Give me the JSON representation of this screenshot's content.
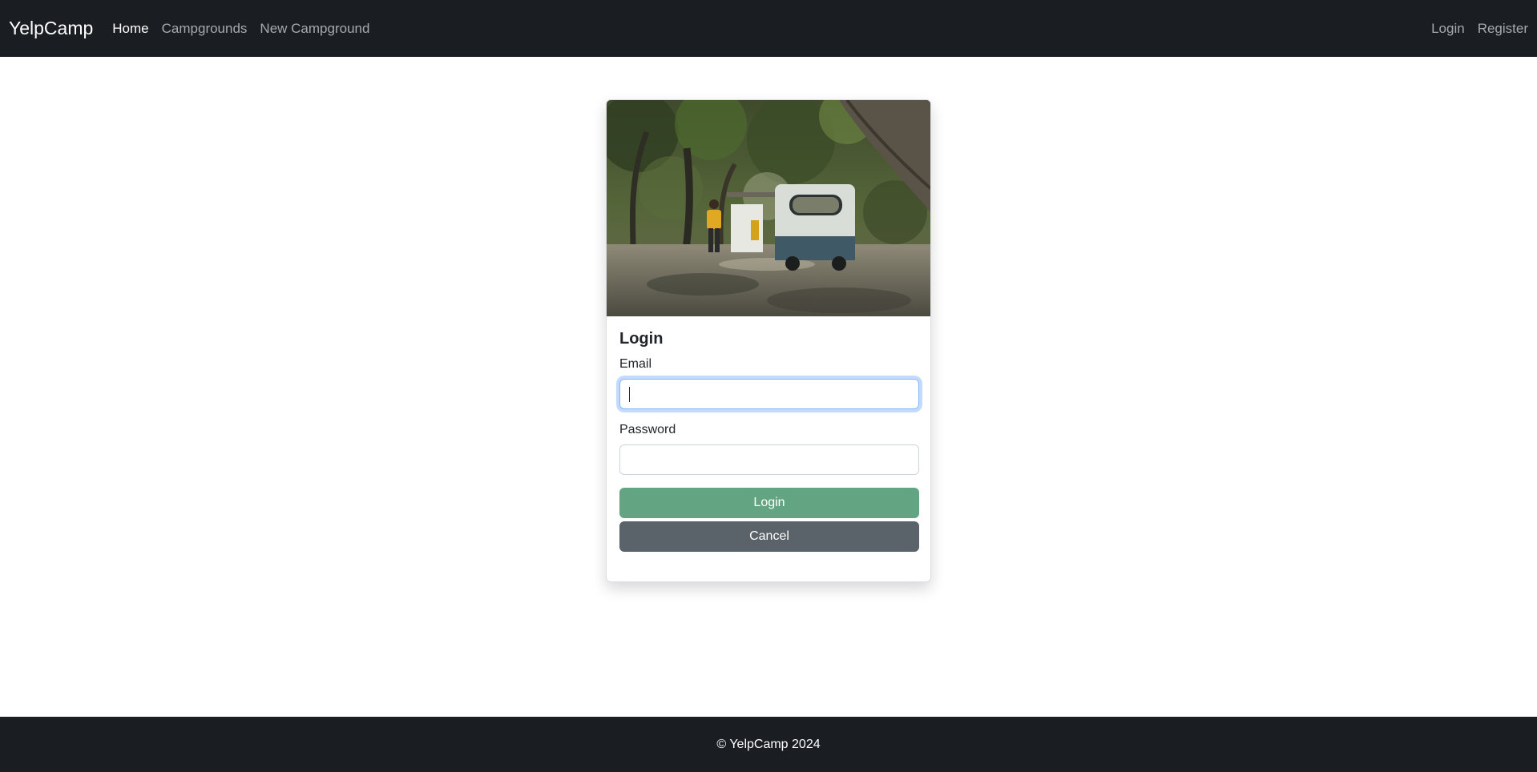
{
  "navbar": {
    "brand": "YelpCamp",
    "links": [
      {
        "label": "Home",
        "active": true
      },
      {
        "label": "Campgrounds",
        "active": false
      },
      {
        "label": "New Campground",
        "active": false
      }
    ],
    "right_links": [
      {
        "label": "Login"
      },
      {
        "label": "Register"
      }
    ]
  },
  "card": {
    "image_icon": "campsite-photo",
    "title": "Login",
    "email": {
      "label": "Email",
      "value": "",
      "placeholder": ""
    },
    "password": {
      "label": "Password",
      "value": "",
      "placeholder": ""
    },
    "login_button": "Login",
    "cancel_button": "Cancel"
  },
  "footer": {
    "text": "© YelpCamp 2024"
  },
  "colors": {
    "navbar_bg": "#1a1d21",
    "login_button": "#63a582",
    "cancel_button": "#5b636a",
    "focus_border": "#86b7fe"
  }
}
